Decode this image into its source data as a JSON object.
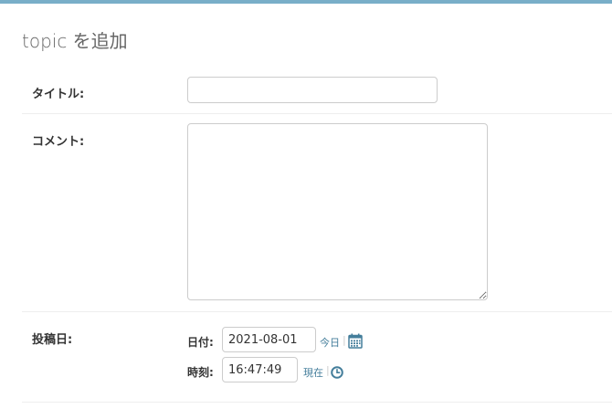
{
  "page": {
    "title": "topic を追加"
  },
  "colors": {
    "accent_bar": "#79aec8",
    "link": "#447e9b"
  },
  "form": {
    "title_field": {
      "label": "タイトル:",
      "value": ""
    },
    "comment_field": {
      "label": "コメント:",
      "value": ""
    },
    "posted_field": {
      "label": "投稿日:",
      "date": {
        "label": "日付:",
        "value": "2021-08-01",
        "shortcut": "今日",
        "separator": "|",
        "icon": "calendar-icon"
      },
      "time": {
        "label": "時刻:",
        "value": "16:47:49",
        "shortcut": "現在",
        "separator": "|",
        "icon": "clock-icon"
      }
    }
  }
}
